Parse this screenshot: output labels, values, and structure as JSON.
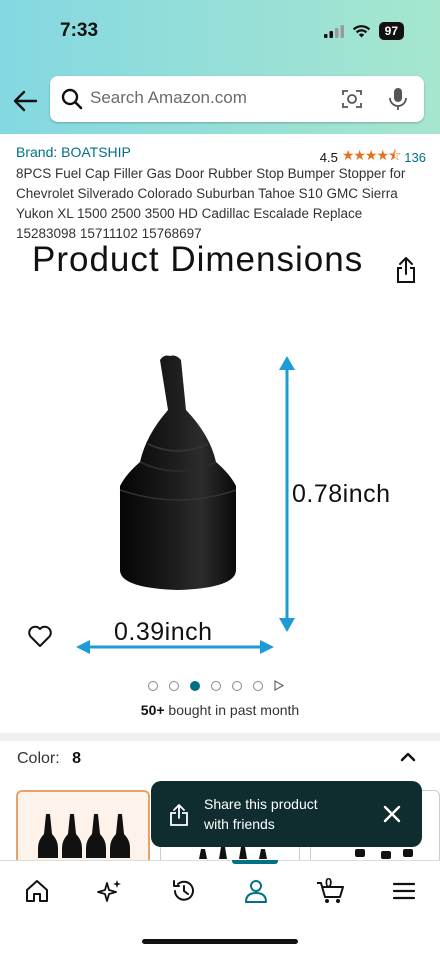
{
  "status_bar": {
    "time": "7:33",
    "battery": "97"
  },
  "search": {
    "placeholder": "Search Amazon.com"
  },
  "product": {
    "brand": "Brand: BOATSHIP",
    "rating": "4.5",
    "rating_count": "136",
    "title": "8PCS Fuel Cap Filler Gas Door Rubber Stop Bumper Stopper for Chevrolet Silverado Colorado Suburban Tahoe S10 GMC Sierra Yukon XL 1500 2500 3500 HD Cadillac Escalade Replace 15283098 15711102 15768697"
  },
  "gallery": {
    "heading": "Product Dimensions",
    "height_label": "0.78inch",
    "width_label": "0.39inch",
    "dots_total": 6,
    "active_dot": 3
  },
  "bought": {
    "count": "50+",
    "text": " bought in past month"
  },
  "color": {
    "label": "Color:",
    "value": "8"
  },
  "toast": {
    "text": "Share this product with friends"
  },
  "nav": {
    "cart_count": "0"
  },
  "colors": {
    "link": "#007185",
    "star": "#e7711b",
    "toast_bg": "#0f2d2f",
    "arrow": "#1c9bd6"
  }
}
